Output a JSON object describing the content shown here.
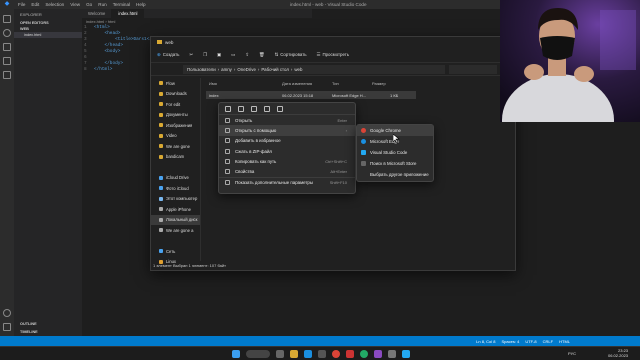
{
  "vscode": {
    "window_title": "index.html - web - Visual Studio Code",
    "menu": [
      "File",
      "Edit",
      "Selection",
      "View",
      "Go",
      "Run",
      "Terminal",
      "Help"
    ],
    "sidebar": {
      "header": "EXPLORER",
      "open_editors": "OPEN EDITORS",
      "folder": "WEB",
      "file": "index.html",
      "outline": "OUTLINE",
      "timeline": "TIMELINE"
    },
    "tabs": [
      "Welcome",
      "index.html"
    ],
    "breadcrumb": "index.html › html",
    "code_lines": [
      {
        "n": "1",
        "text": "<html>"
      },
      {
        "n": "2",
        "text": "    <head>"
      },
      {
        "n": "3",
        "text": "        <title>Dars1</title>"
      },
      {
        "n": "4",
        "text": "    </head>"
      },
      {
        "n": "5",
        "text": "    <body>"
      },
      {
        "n": "6",
        "text": ""
      },
      {
        "n": "7",
        "text": "    </body>"
      },
      {
        "n": "8",
        "text": "</html>"
      }
    ],
    "status": {
      "position": "Ln 8, Col 8",
      "spaces": "Spaces: 4",
      "encoding": "UTF-8",
      "eol": "CRLF",
      "lang": "HTML"
    }
  },
  "explorer": {
    "title": "web",
    "toolbar": {
      "new": "Создать",
      "sort": "Сортировать",
      "view": "Просмотреть"
    },
    "path": [
      "Пользователи",
      "amny",
      "OneDrive",
      "Рабочий стол",
      "web"
    ],
    "nav": [
      "Flow",
      "Downloads",
      "For edit",
      "Документы",
      "Изображения",
      "Video",
      "We are gone",
      "bandicam",
      "",
      "iCloud Drive",
      "Фото iCloud",
      "Этот компьютер",
      "Apple iPhone",
      "Локальный диск",
      "We are gone a",
      "",
      "Сеть",
      "Linux"
    ],
    "columns": [
      "Имя",
      "Дата изменения",
      "Тип",
      "Размер"
    ],
    "file_row": {
      "name": "index",
      "date": "06.02.2023 15:18",
      "type": "Microsoft Edge H...",
      "size": "1 КБ"
    },
    "status": "1 элемент   Выбран 1 элемент: 107 байт"
  },
  "context_menu": {
    "items": [
      {
        "label": "Открыть",
        "shortcut": "Enter"
      },
      {
        "label": "Открыть с помощью",
        "shortcut": ""
      },
      {
        "label": "Добавить в избранное",
        "shortcut": ""
      },
      {
        "label": "Сжать в ZIP-файл",
        "shortcut": ""
      },
      {
        "label": "Копировать как путь",
        "shortcut": "Ctrl+Shift+C"
      },
      {
        "label": "Свойства",
        "shortcut": "Alt+Enter"
      },
      {
        "label": "Показать дополнительные параметры",
        "shortcut": "Shift+F10"
      }
    ],
    "submenu": [
      "Google Chrome",
      "Microsoft Edge",
      "Visual Studio Code",
      "Поиск в Microsoft Store",
      "Выбрать другое приложение"
    ]
  },
  "taskbar": {
    "time": "23:23",
    "date": "06.02.2023",
    "lang": "РУС"
  },
  "colors": {
    "accent": "#007acc",
    "chrome_red": "#db4437",
    "edge_blue": "#1a8fe0",
    "vscode_blue": "#23a9f2"
  }
}
